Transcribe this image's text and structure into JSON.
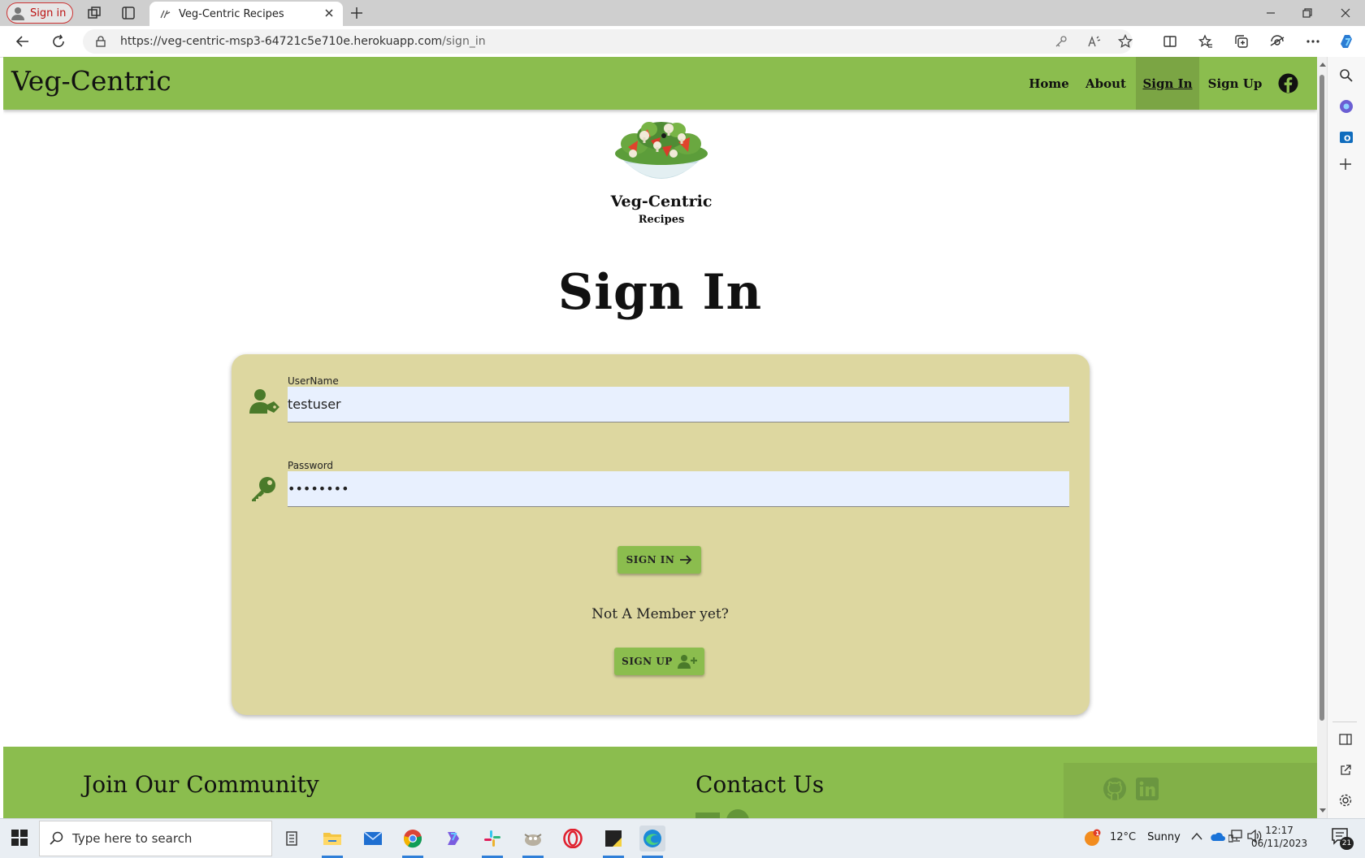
{
  "browser": {
    "profile_label": "Sign in",
    "tab_title": "Veg-Centric Recipes",
    "url_main": "https://veg-centric-msp3-64721c5e710e.herokuapp.com",
    "url_path": "/sign_in"
  },
  "navbar": {
    "brand": "Veg-Centric",
    "links": [
      "Home",
      "About",
      "Sign In",
      "Sign Up"
    ],
    "active_link": "Sign In"
  },
  "logo": {
    "name": "Veg-Centric",
    "subtitle": "Recipes"
  },
  "page_title": "Sign In",
  "form": {
    "username": {
      "label": "UserName",
      "value": "testuser"
    },
    "password": {
      "label": "Password",
      "value": "••••••••"
    },
    "sign_in_label": "SIGN IN",
    "not_member_text": "Not A Member yet?",
    "sign_up_label": "SIGN UP"
  },
  "footer": {
    "community_heading": "Join Our Community",
    "contact_heading": "Contact Us",
    "social_icons": [
      "github-icon",
      "linkedin-icon"
    ]
  },
  "taskbar": {
    "search_placeholder": "Type here to search",
    "weather_temp": "12°C",
    "weather_desc": "Sunny",
    "time": "12:17",
    "date": "06/11/2023",
    "notification_count": "21"
  },
  "colors": {
    "nav_green": "#8bbd4e",
    "card_beige": "#ddd7a0",
    "icon_green": "#4a7a2a"
  }
}
